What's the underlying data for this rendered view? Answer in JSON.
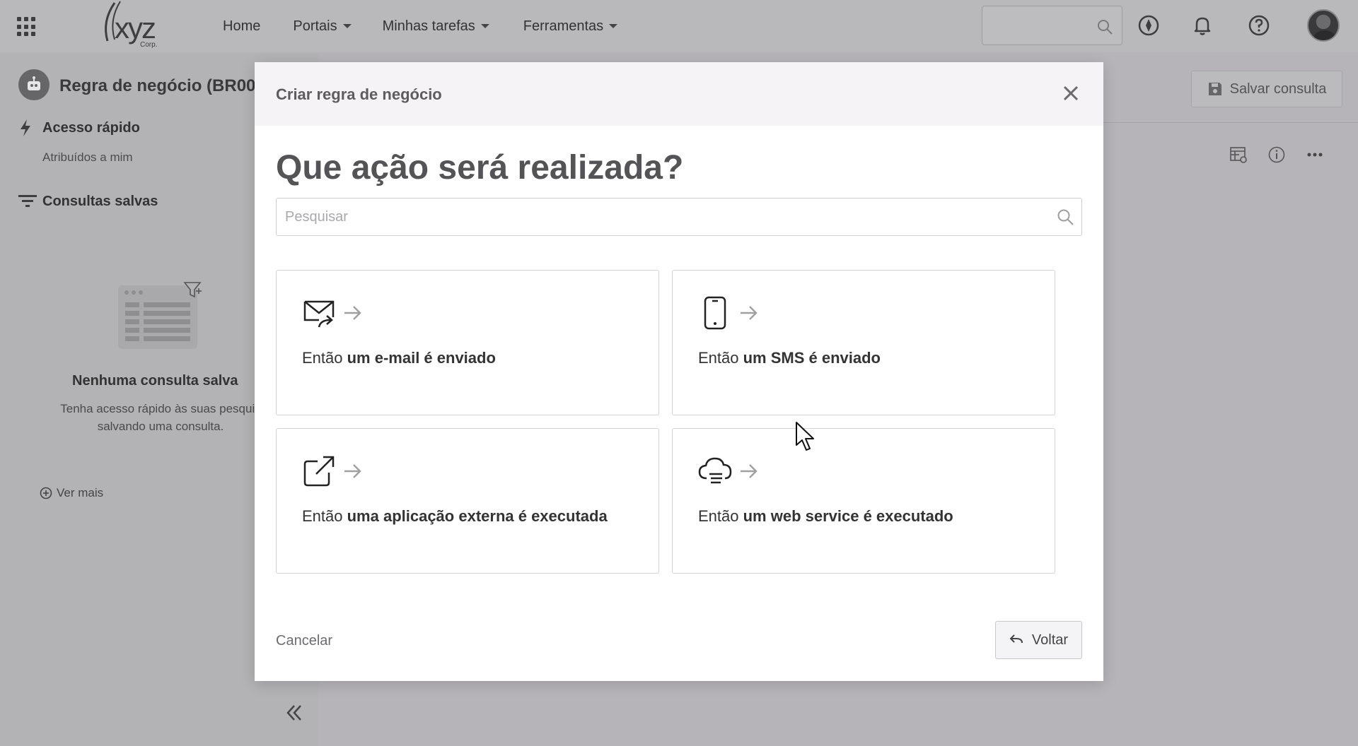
{
  "topbar": {
    "logo_text": "xyz",
    "logo_sub": "Corp.",
    "nav": [
      {
        "label": "Home",
        "has_caret": false
      },
      {
        "label": "Portais",
        "has_caret": true
      },
      {
        "label": "Minhas tarefas",
        "has_caret": true
      },
      {
        "label": "Ferramentas",
        "has_caret": true
      }
    ],
    "icons": [
      "apps-grid-icon",
      "search-icon",
      "compass-icon",
      "bell-icon",
      "help-icon",
      "user-avatar"
    ]
  },
  "sidebar": {
    "page_title": "Regra de negócio (BR00",
    "quick_access": {
      "title": "Acesso rápido",
      "item": "Atribuídos a mim"
    },
    "saved_queries": {
      "title": "Consultas salvas"
    },
    "empty_state": {
      "title": "Nenhuma consulta salva",
      "description_line1": "Tenha acesso rápido às suas pesquis",
      "description_line2": "salvando uma consulta."
    },
    "see_more": "Ver mais",
    "collapse_icon": "chevrons-left-icon"
  },
  "main": {
    "save_query_label": "Salvar consulta",
    "toolbar_icons": [
      "table-settings-icon",
      "info-icon",
      "more-icon"
    ]
  },
  "modal": {
    "title": "Criar regra de negócio",
    "question": "Que ação será realizada?",
    "search_placeholder": "Pesquisar",
    "options": [
      {
        "prefix": "Então ",
        "bold": "um e-mail é enviado",
        "icon": "email-send-icon"
      },
      {
        "prefix": "Então ",
        "bold": "um SMS é enviado",
        "icon": "mobile-phone-icon"
      },
      {
        "prefix": "Então ",
        "bold": "uma aplicação externa é executada",
        "icon": "external-link-icon"
      },
      {
        "prefix": "Então ",
        "bold": "um web service é executado",
        "icon": "cloud-service-icon"
      }
    ],
    "cancel_label": "Cancelar",
    "back_label": "Voltar"
  },
  "colors": {
    "overlay": "#b6b4b8",
    "modal_header": "#f6f3f7",
    "card_border": "#d3d3d7"
  }
}
